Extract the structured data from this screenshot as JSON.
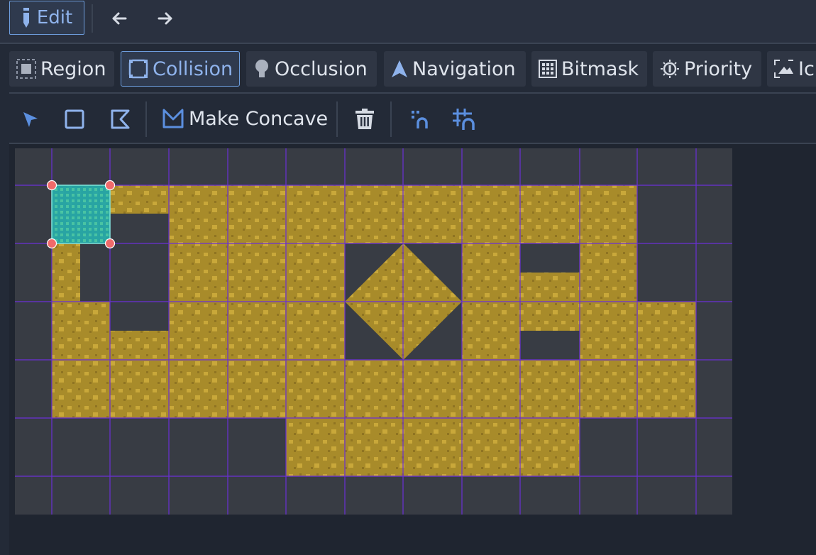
{
  "toolbar": {
    "edit_label": "Edit",
    "back_icon": "arrow-left-icon",
    "forward_icon": "arrow-right-icon"
  },
  "tabs": [
    {
      "label": "Region",
      "icon": "region-icon",
      "active": false
    },
    {
      "label": "Collision",
      "icon": "collision-icon",
      "active": true
    },
    {
      "label": "Occlusion",
      "icon": "occlusion-icon",
      "active": false
    },
    {
      "label": "Navigation",
      "icon": "navigation-icon",
      "active": false
    },
    {
      "label": "Bitmask",
      "icon": "bitmask-icon",
      "active": false
    },
    {
      "label": "Priority",
      "icon": "priority-icon",
      "active": false
    },
    {
      "label": "Ic",
      "icon": "icon-icon",
      "active": false
    }
  ],
  "tools": {
    "select_icon": "select-arrow-icon",
    "rectangle_icon": "rectangle-icon",
    "polygon_icon": "polygon-icon",
    "make_concave_label": "Make Concave",
    "delete_icon": "trash-icon",
    "snap_icon": "snap-icon",
    "grid_snap_icon": "grid-snap-icon"
  },
  "colors": {
    "accent": "#6e9ede",
    "tile_gold": "#a88b2a",
    "tile_gold_light": "#c9a83a",
    "collision_fill": "#1aa7b0",
    "handle": "#f06a6a",
    "grid_line": "#6b2fd6",
    "atlas_bg": "#383c44"
  },
  "atlas": {
    "columns": 12,
    "rows": 6,
    "tiles": [
      [
        0,
        0,
        0,
        0,
        0,
        0,
        0,
        0,
        0,
        0,
        0,
        0
      ],
      [
        0,
        1,
        1,
        1,
        1,
        1,
        1,
        1,
        1,
        1,
        1,
        0
      ],
      [
        0,
        1,
        0,
        1,
        1,
        1,
        2,
        2,
        1,
        1,
        1,
        0
      ],
      [
        0,
        1,
        1,
        1,
        1,
        1,
        2,
        2,
        1,
        1,
        1,
        1
      ],
      [
        0,
        1,
        1,
        1,
        1,
        1,
        1,
        1,
        1,
        1,
        1,
        1
      ],
      [
        0,
        0,
        0,
        0,
        0,
        1,
        1,
        1,
        1,
        1,
        0,
        0
      ]
    ],
    "selected_tile": [
      1,
      1
    ]
  }
}
